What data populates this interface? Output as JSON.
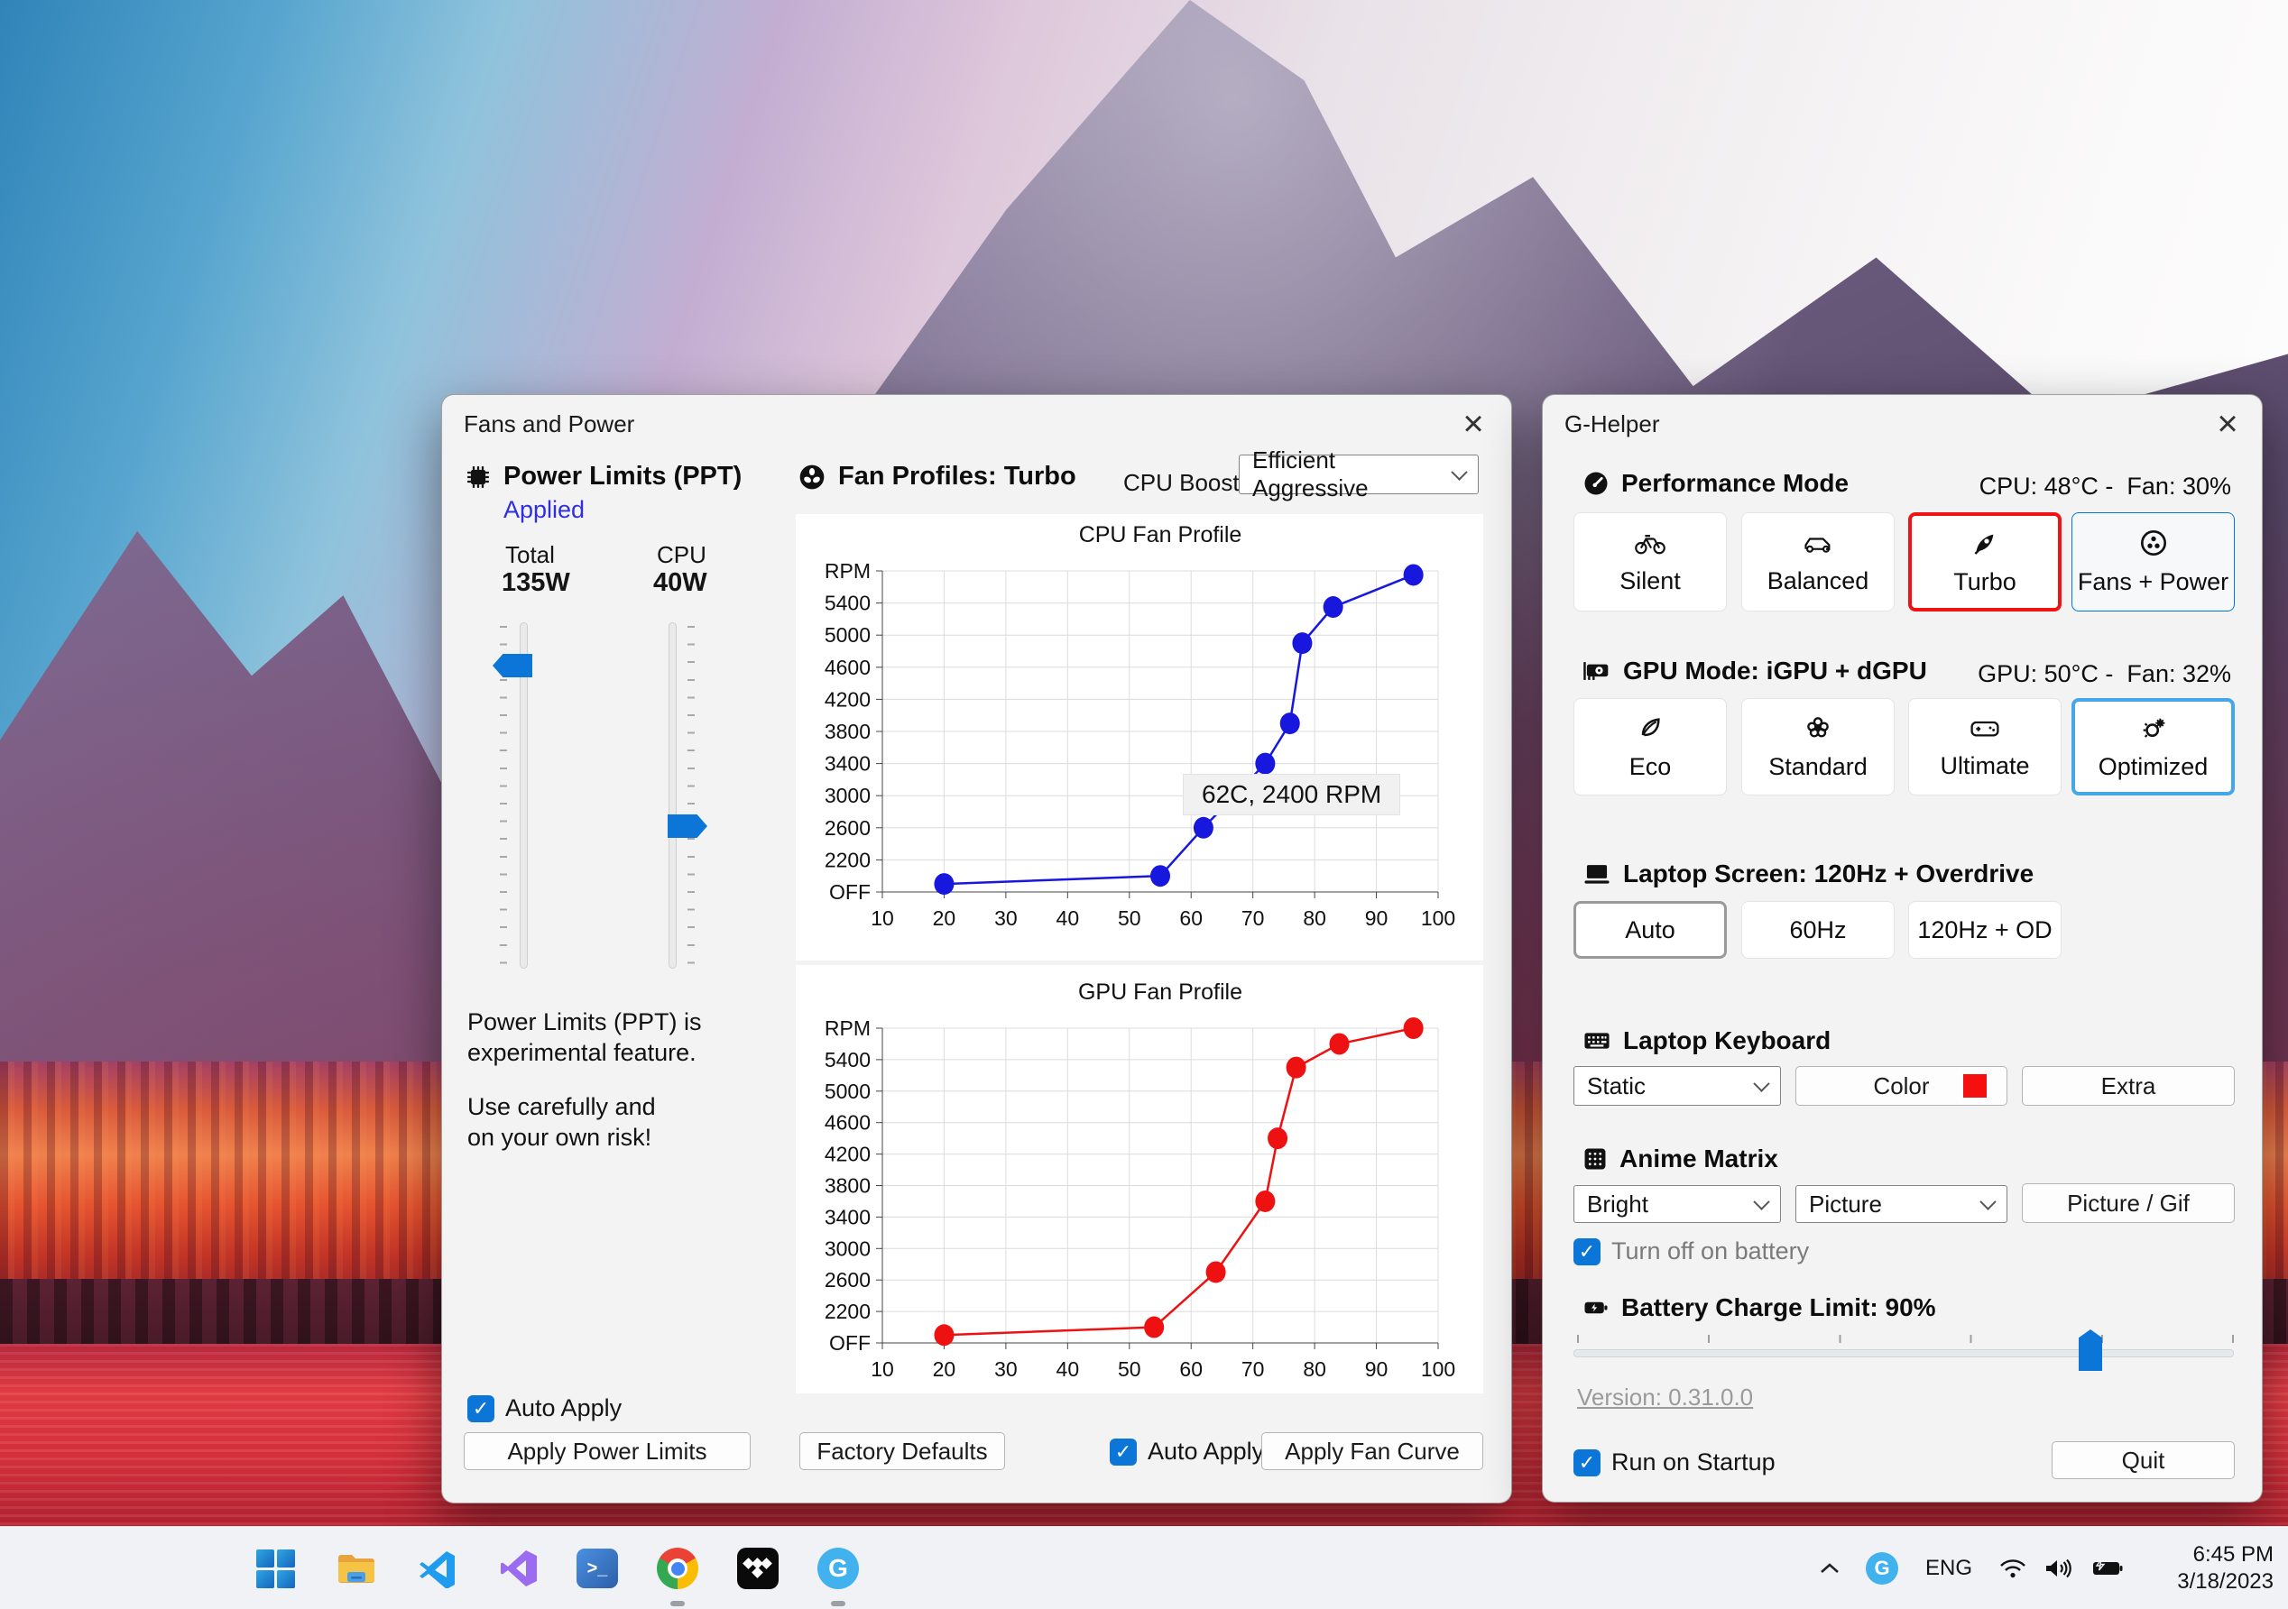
{
  "colors": {
    "accent_blue": "#0b76d8",
    "selected_red_border": "#ef1313",
    "selected_blue_border": "#45a7ea",
    "nav_blue_border": "#0078d7",
    "applied_blue": "#2f2fe0",
    "cpu_curve": "#1717dd",
    "gpu_curve": "#ed1111",
    "keyboard_color_swatch": "#f50f0f"
  },
  "left_window": {
    "title": "Fans and Power",
    "close_glyph": "×",
    "power_limits": {
      "header": "Power Limits (PPT)",
      "status": "Applied",
      "total_label": "Total",
      "total_value": "135W",
      "cpu_label": "CPU",
      "cpu_value": "40W",
      "warning_line1": "Power Limits (PPT) is",
      "warning_line2": "experimental feature.",
      "warning_line3": "Use carefully and",
      "warning_line4": "on your own risk!",
      "auto_apply_label": "Auto Apply",
      "apply_button": "Apply Power Limits"
    },
    "fan_profiles": {
      "header": "Fan Profiles: Turbo",
      "cpu_boost_label": "CPU Boost",
      "cpu_boost_value": "Efficient Aggressive",
      "factory_defaults_button": "Factory Defaults",
      "auto_apply_label": "Auto Apply",
      "apply_button": "Apply Fan Curve"
    }
  },
  "chart_data": [
    {
      "type": "line",
      "title": "CPU Fan Profile",
      "xticks": [
        10,
        20,
        30,
        40,
        50,
        60,
        70,
        80,
        90,
        100
      ],
      "ytick_labels": [
        "OFF",
        "2200",
        "2600",
        "3000",
        "3400",
        "3800",
        "4200",
        "4600",
        "5000",
        "5400",
        "RPM"
      ],
      "yrange": [
        1800,
        5800
      ],
      "xlim": [
        10,
        100
      ],
      "grid": true,
      "legend_position": "none",
      "series": [
        {
          "name": "CPU fan curve",
          "color": "#1717dd",
          "points": [
            [
              20,
              1900
            ],
            [
              55,
              2000
            ],
            [
              62,
              2600
            ],
            [
              72,
              3400
            ],
            [
              76,
              3900
            ],
            [
              78,
              4900
            ],
            [
              83,
              5350
            ],
            [
              96,
              5750
            ]
          ]
        }
      ],
      "annotation": "62C, 2400 RPM"
    },
    {
      "type": "line",
      "title": "GPU Fan Profile",
      "xticks": [
        10,
        20,
        30,
        40,
        50,
        60,
        70,
        80,
        90,
        100
      ],
      "ytick_labels": [
        "OFF",
        "2200",
        "2600",
        "3000",
        "3400",
        "3800",
        "4200",
        "4600",
        "5000",
        "5400",
        "RPM"
      ],
      "yrange": [
        1800,
        5800
      ],
      "xlim": [
        10,
        100
      ],
      "grid": true,
      "legend_position": "none",
      "series": [
        {
          "name": "GPU fan curve",
          "color": "#ed1111",
          "points": [
            [
              20,
              1900
            ],
            [
              54,
              2000
            ],
            [
              64,
              2700
            ],
            [
              72,
              3600
            ],
            [
              74,
              4400
            ],
            [
              77,
              5300
            ],
            [
              84,
              5600
            ],
            [
              96,
              5800
            ]
          ]
        }
      ]
    }
  ],
  "right_window": {
    "title": "G-Helper",
    "close_glyph": "×",
    "performance": {
      "header": "Performance Mode",
      "status": "CPU: 48°C -  Fan: 30%",
      "selected": "Turbo",
      "modes": [
        {
          "label": "Silent"
        },
        {
          "label": "Balanced"
        },
        {
          "label": "Turbo"
        },
        {
          "label": "Fans + Power"
        }
      ]
    },
    "gpu": {
      "header": "GPU Mode: iGPU + dGPU",
      "status": "GPU: 50°C -  Fan: 32%",
      "selected": "Optimized",
      "modes": [
        {
          "label": "Eco"
        },
        {
          "label": "Standard"
        },
        {
          "label": "Ultimate"
        },
        {
          "label": "Optimized"
        }
      ]
    },
    "screen": {
      "header": "Laptop Screen: 120Hz + Overdrive",
      "selected": "Auto",
      "options": [
        {
          "label": "Auto"
        },
        {
          "label": "60Hz"
        },
        {
          "label": "120Hz + OD"
        }
      ]
    },
    "keyboard": {
      "header": "Laptop Keyboard",
      "mode_value": "Static",
      "color_button": "Color",
      "extra_button": "Extra"
    },
    "anime_matrix": {
      "header": "Anime Matrix",
      "brightness_value": "Bright",
      "mode_value": "Picture",
      "picture_button": "Picture / Gif",
      "battery_checkbox_label": "Turn off on battery"
    },
    "battery": {
      "header": "Battery Charge Limit: 90%",
      "value_percent": 90
    },
    "version_link": "Version: 0.31.0.0",
    "run_on_startup_label": "Run on Startup",
    "quit_button": "Quit"
  },
  "taskbar": {
    "apps": [
      "Start",
      "File Explorer",
      "Visual Studio Code",
      "Visual Studio",
      "PowerShell",
      "Google Chrome",
      "Tidal",
      "G-Helper"
    ],
    "running_indicator_apps": [
      "Google Chrome",
      "G-Helper"
    ],
    "ps_glyph": ">_",
    "g_letter": "G",
    "tray": {
      "language": "ENG",
      "time": "6:45 PM",
      "date": "3/18/2023"
    }
  }
}
